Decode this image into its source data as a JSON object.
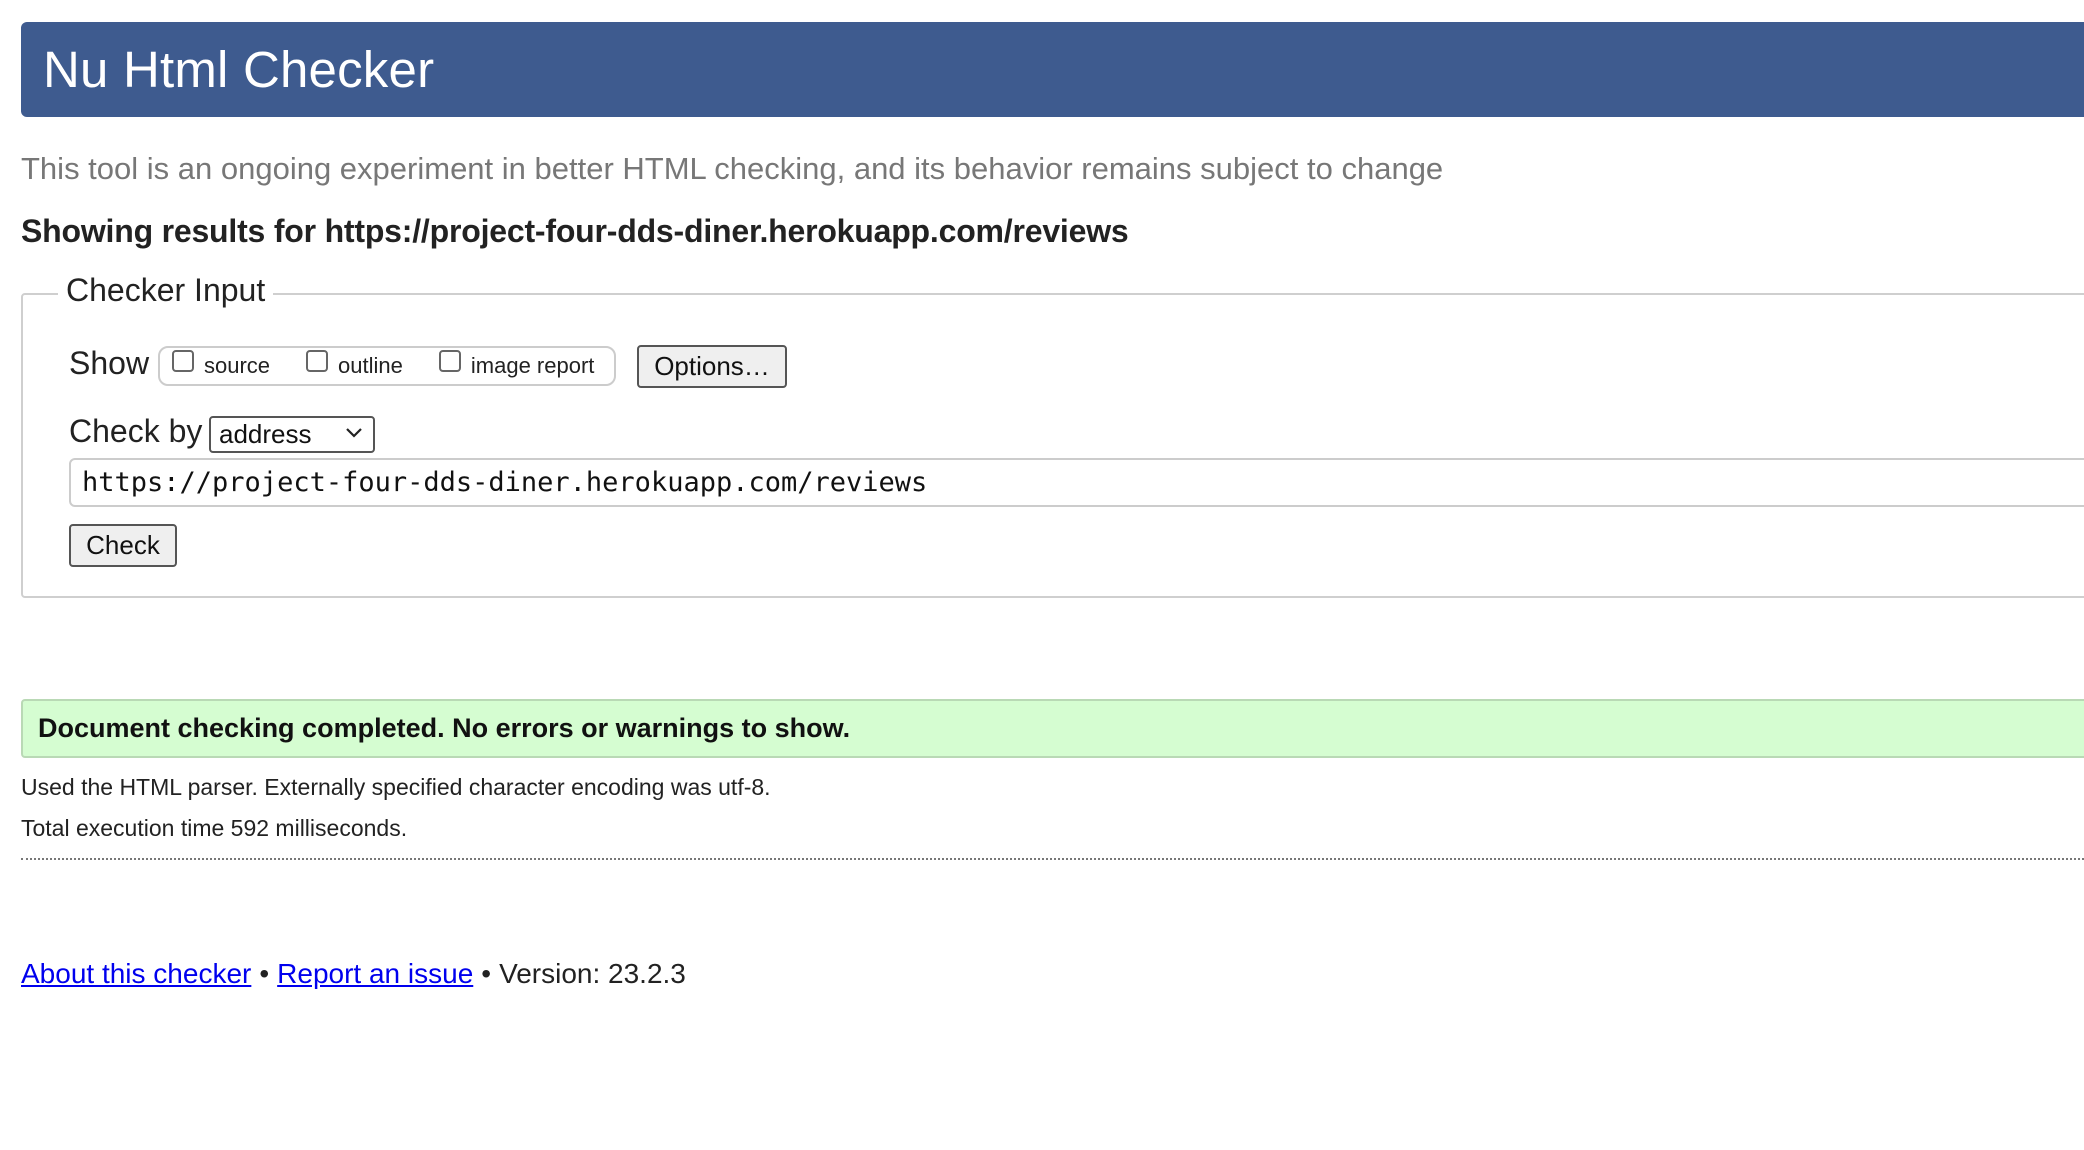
{
  "header": {
    "title": "Nu Html Checker"
  },
  "intro": "This tool is an ongoing experiment in better HTML checking, and its behavior remains subject to change",
  "results_heading": "Showing results for https://project-four-dds-diner.herokuapp.com/reviews",
  "checker_input": {
    "legend": "Checker Input",
    "show_label": "Show",
    "show_options": [
      {
        "label": "source",
        "checked": false
      },
      {
        "label": "outline",
        "checked": false
      },
      {
        "label": "image report",
        "checked": false
      }
    ],
    "options_button": "Options…",
    "check_by_label": "Check by",
    "check_by_selected": "address",
    "url_value": "https://project-four-dds-diner.herokuapp.com/reviews",
    "check_button": "Check"
  },
  "result": {
    "success_message": "Document checking completed. No errors or warnings to show.",
    "parser_info": "Used the HTML parser. Externally specified character encoding was utf-8.",
    "execution_time": "Total execution time 592 milliseconds."
  },
  "footer": {
    "about_link": "About this checker",
    "separator": "•",
    "report_link": "Report an issue",
    "version": "Version: 23.2.3"
  },
  "colors": {
    "header_bg": "#3e5b8f",
    "success_bg": "#d5fdd1",
    "link": "#0000ee"
  }
}
